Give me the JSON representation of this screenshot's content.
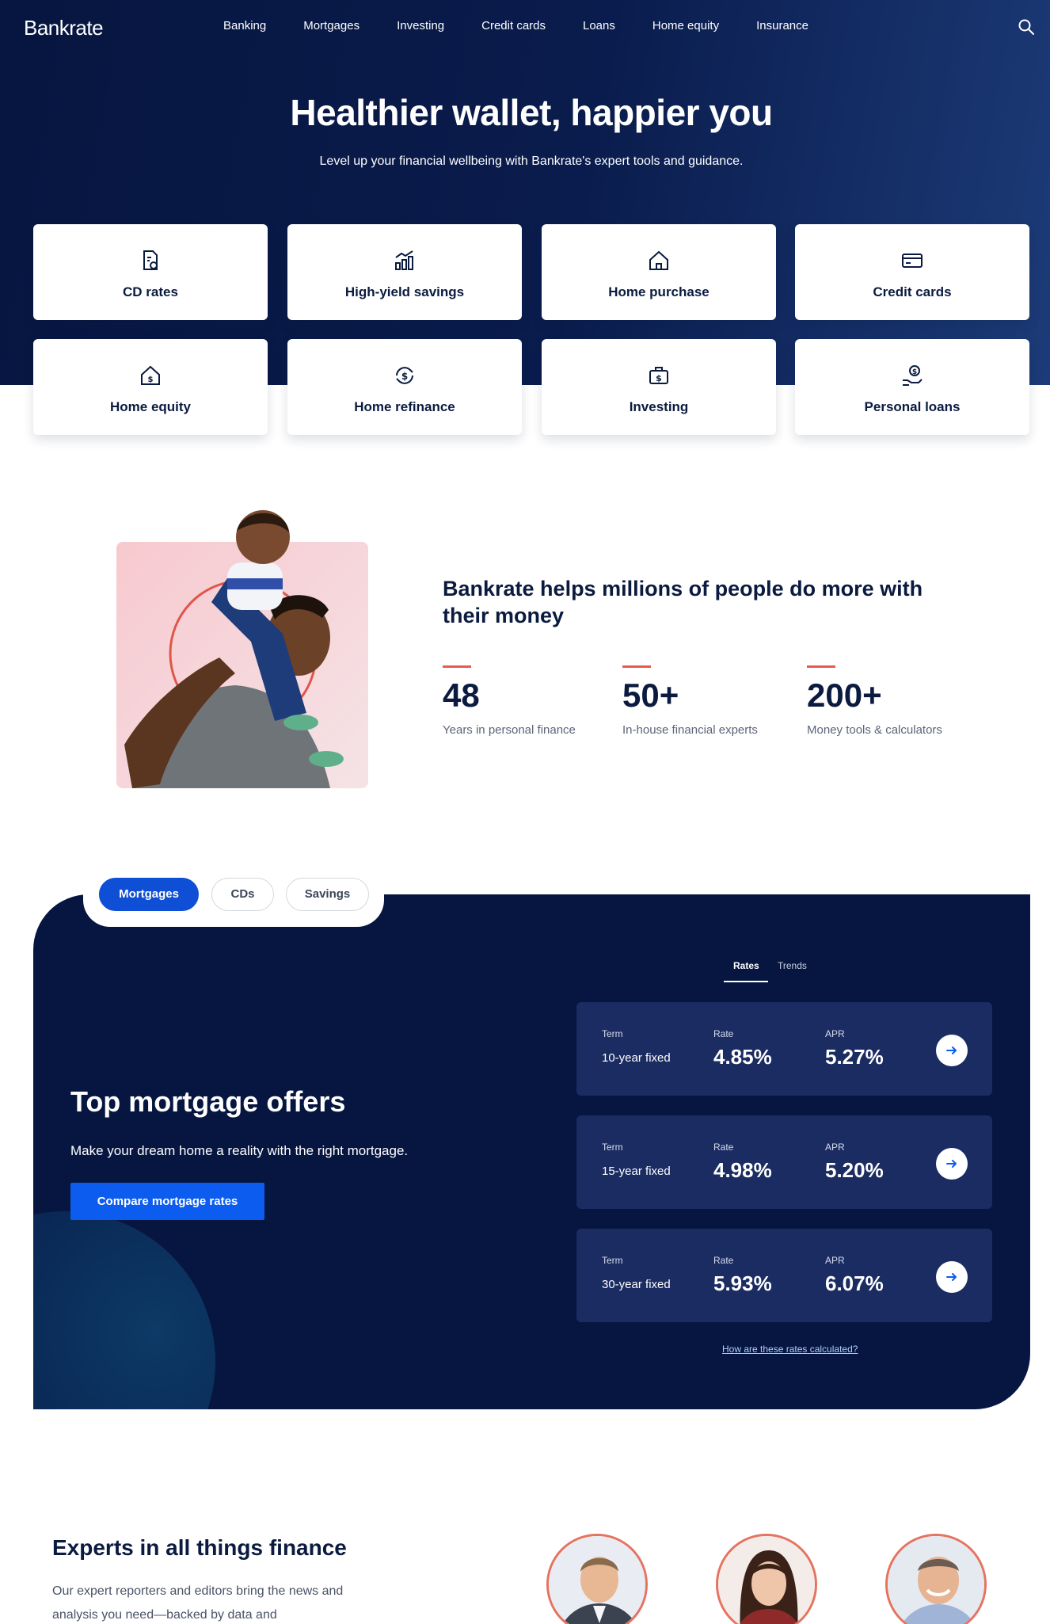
{
  "nav": {
    "logo": "Bankrate",
    "links": [
      "Banking",
      "Mortgages",
      "Investing",
      "Credit cards",
      "Loans",
      "Home equity",
      "Insurance"
    ]
  },
  "hero": {
    "title": "Healthier wallet, happier you",
    "subtitle": "Level up your financial wellbeing with Bankrate's expert tools and guidance.",
    "tiles": [
      {
        "label": "CD rates",
        "icon": "cd-document-icon"
      },
      {
        "label": "High-yield savings",
        "icon": "growth-chart-icon"
      },
      {
        "label": "Home purchase",
        "icon": "house-icon"
      },
      {
        "label": "Credit cards",
        "icon": "credit-card-icon"
      },
      {
        "label": "Home equity",
        "icon": "house-dollar-icon"
      },
      {
        "label": "Home refinance",
        "icon": "refresh-dollar-icon"
      },
      {
        "label": "Investing",
        "icon": "briefcase-dollar-icon"
      },
      {
        "label": "Personal loans",
        "icon": "hand-dollar-icon"
      }
    ]
  },
  "stats": {
    "heading": "Bankrate helps millions of people do more with their money",
    "items": [
      {
        "value": "48",
        "label": "Years in personal finance"
      },
      {
        "value": "50+",
        "label": "In-house financial experts"
      },
      {
        "value": "200+",
        "label": "Money tools & calculators"
      }
    ]
  },
  "rates": {
    "pills": [
      {
        "label": "Mortgages",
        "active": true
      },
      {
        "label": "CDs",
        "active": false
      },
      {
        "label": "Savings",
        "active": false
      }
    ],
    "title": "Top mortgage offers",
    "subtitle": "Make your dream home a reality with the right mortgage.",
    "cta": "Compare mortgage rates",
    "tabs": {
      "rates": "Rates",
      "trends": "Trends"
    },
    "column_labels": {
      "term": "Term",
      "rate": "Rate",
      "apr": "APR"
    },
    "rows": [
      {
        "term": "10-year fixed",
        "rate": "4.85%",
        "apr": "5.27%"
      },
      {
        "term": "15-year fixed",
        "rate": "4.98%",
        "apr": "5.20%"
      },
      {
        "term": "30-year fixed",
        "rate": "5.93%",
        "apr": "6.07%"
      }
    ],
    "footnote": "How are these rates calculated?"
  },
  "experts": {
    "title": "Experts in all things finance",
    "text": "Our expert reporters and editors bring the news and analysis you need—backed by data and"
  },
  "colors": {
    "hero_bg": "#0a1c4d",
    "panel_bg": "#061640",
    "accent_blue": "#0d5cf0",
    "accent_red": "#ea5a4c"
  }
}
